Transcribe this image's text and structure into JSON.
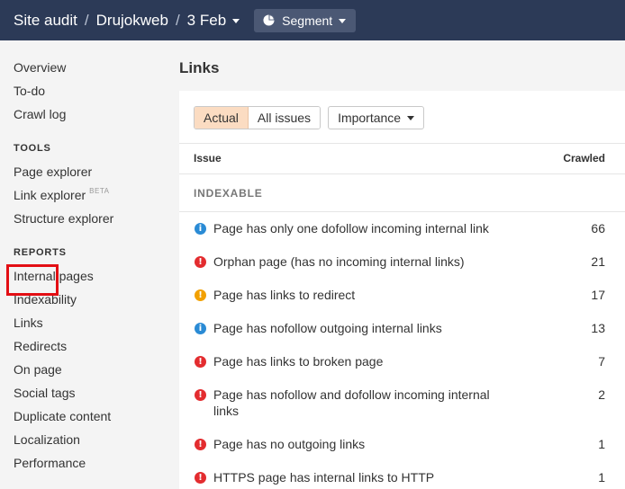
{
  "header": {
    "breadcrumbs": [
      "Site audit",
      "Drujokweb"
    ],
    "date": "3 Feb",
    "segment_label": "Segment"
  },
  "sidebar": {
    "top_items": [
      "Overview",
      "To-do",
      "Crawl log"
    ],
    "tools_heading": "TOOLS",
    "tools": [
      "Page explorer",
      "Link explorer",
      "Structure explorer"
    ],
    "beta_badge": "BETA",
    "reports_heading": "REPORTS",
    "reports": [
      "Internal pages",
      "Indexability",
      "Links",
      "Redirects",
      "On page",
      "Social tags",
      "Duplicate content",
      "Localization",
      "Performance"
    ],
    "active_item": "Links"
  },
  "main": {
    "title": "Links",
    "filters": {
      "actual_label": "Actual",
      "all_issues_label": "All issues",
      "importance_label": "Importance"
    },
    "table": {
      "col_issue": "Issue",
      "col_crawled": "Crawled",
      "group_label": "INDEXABLE",
      "rows": [
        {
          "severity": "info",
          "icon": "i",
          "issue": "Page has only one dofollow incoming internal link",
          "crawled": "66"
        },
        {
          "severity": "error",
          "icon": "!",
          "issue": "Orphan page (has no incoming internal links)",
          "crawled": "21"
        },
        {
          "severity": "warn",
          "icon": "!",
          "issue": "Page has links to redirect",
          "crawled": "17"
        },
        {
          "severity": "info",
          "icon": "i",
          "issue": "Page has nofollow outgoing internal links",
          "crawled": "13"
        },
        {
          "severity": "error",
          "icon": "!",
          "issue": "Page has links to broken page",
          "crawled": "7"
        },
        {
          "severity": "error",
          "icon": "!",
          "issue": "Page has nofollow and dofollow incoming internal links",
          "crawled": "2"
        },
        {
          "severity": "error",
          "icon": "!",
          "issue": "Page has no outgoing links",
          "crawled": "1"
        },
        {
          "severity": "error",
          "icon": "!",
          "issue": "HTTPS page has internal links to HTTP",
          "crawled": "1"
        }
      ]
    }
  },
  "colors": {
    "topbar": "#2c3a57",
    "info": "#2a8bd5",
    "error": "#e32c2f",
    "warning": "#f2a000",
    "active_filter": "#fbdcc2",
    "highlight": "#e30e14"
  }
}
